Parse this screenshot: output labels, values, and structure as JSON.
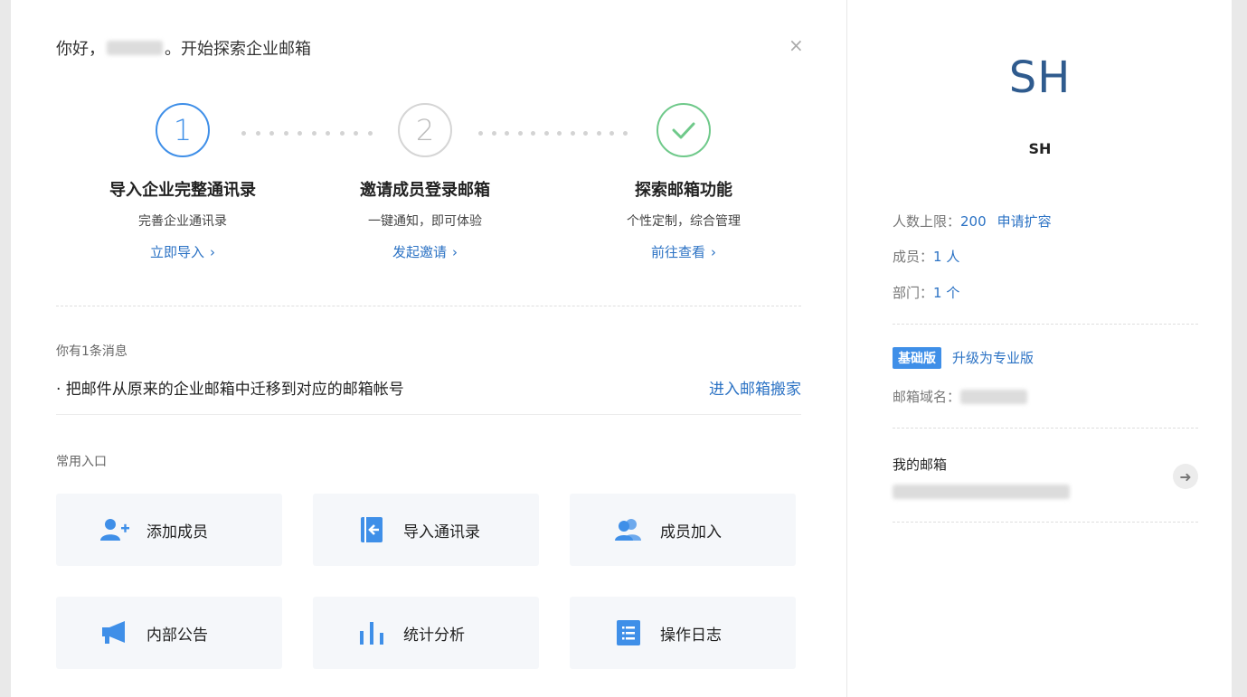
{
  "greeting": {
    "prefix": "你好，",
    "suffix": "。开始探索企业邮箱"
  },
  "close_icon": "×",
  "steps": [
    {
      "number": "1",
      "title": "导入企业完整通讯录",
      "desc": "完善企业通讯录",
      "link": "立即导入"
    },
    {
      "number": "2",
      "title": "邀请成员登录邮箱",
      "desc": "一键通知，即可体验",
      "link": "发起邀请"
    },
    {
      "number": "check",
      "title": "探索邮箱功能",
      "desc": "个性定制，综合管理",
      "link": "前往查看"
    }
  ],
  "chevron": "›",
  "messages": {
    "count_label": "你有1条消息",
    "item": "· 把邮件从原来的企业邮箱中迁移到对应的邮箱帐号",
    "action": "进入邮箱搬家"
  },
  "shortcuts": {
    "title": "常用入口",
    "items": [
      {
        "label": "添加成员",
        "icon": "add-user-icon"
      },
      {
        "label": "导入通讯录",
        "icon": "import-contacts-icon"
      },
      {
        "label": "成员加入",
        "icon": "members-join-icon"
      },
      {
        "label": "内部公告",
        "icon": "megaphone-icon"
      },
      {
        "label": "统计分析",
        "icon": "bar-chart-icon"
      },
      {
        "label": "操作日志",
        "icon": "log-list-icon"
      }
    ]
  },
  "side": {
    "avatar_text": "SH",
    "org_name": "SH",
    "limit_label": "人数上限：",
    "limit_value": "200",
    "expand_link": "申请扩容",
    "members_label": "成员：",
    "members_value": "1 人",
    "depts_label": "部门：",
    "depts_value": "1 个",
    "edition_badge": "基础版",
    "upgrade_link": "升级为专业版",
    "domain_label": "邮箱域名：",
    "mailbox_label": "我的邮箱",
    "arrow": "➜"
  },
  "colors": {
    "accent": "#3f8fe8",
    "link": "#2b72c4",
    "success": "#6fc98a",
    "avatar": "#2f5b8e"
  }
}
